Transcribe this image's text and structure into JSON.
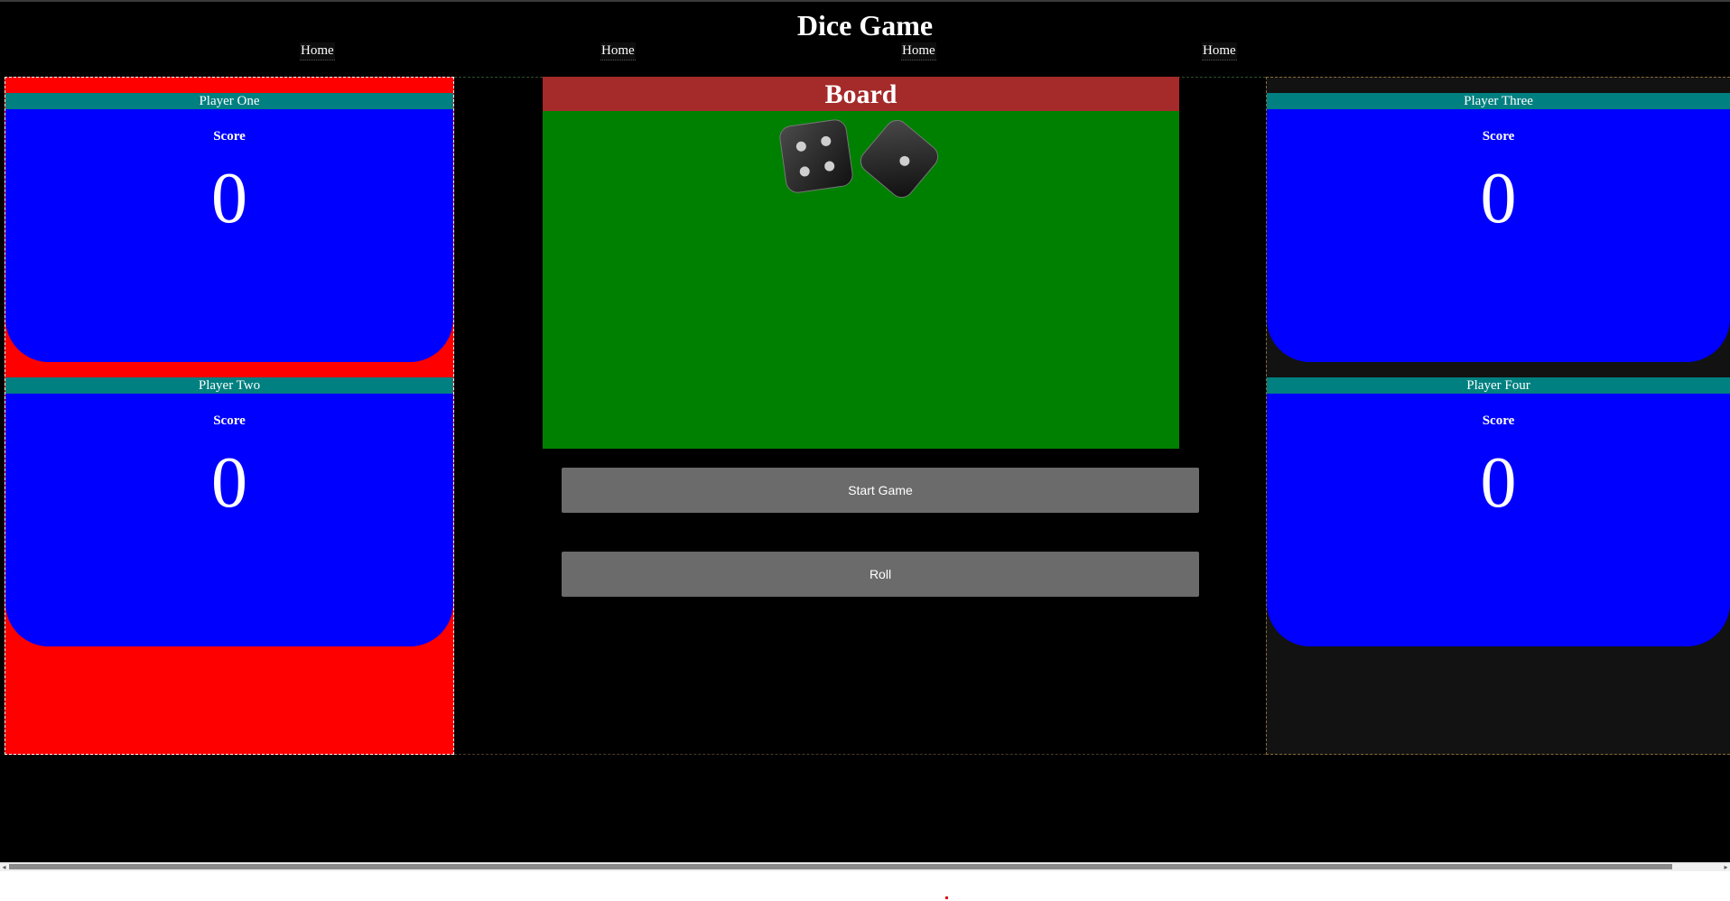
{
  "title": "Dice Game",
  "nav": [
    {
      "label": "Home"
    },
    {
      "label": "Home"
    },
    {
      "label": "Home"
    },
    {
      "label": "Home"
    }
  ],
  "players": [
    {
      "name": "Player One",
      "score_label": "Score",
      "score": "0"
    },
    {
      "name": "Player Two",
      "score_label": "Score",
      "score": "0"
    },
    {
      "name": "Player Three",
      "score_label": "Score",
      "score": "0"
    },
    {
      "name": "Player Four",
      "score_label": "Score",
      "score": "0"
    }
  ],
  "board": {
    "title": "Board",
    "dice": [
      {
        "face": 4
      },
      {
        "face": 1
      }
    ]
  },
  "buttons": {
    "start": "Start Game",
    "roll": "Roll"
  },
  "colors": {
    "background": "#000000",
    "board_header": "#a52a2a",
    "board_surface": "#008000",
    "player_header": "#008080",
    "player_body": "#0000ff",
    "left_panel": "#ff0000",
    "button": "#6b6b6b"
  }
}
